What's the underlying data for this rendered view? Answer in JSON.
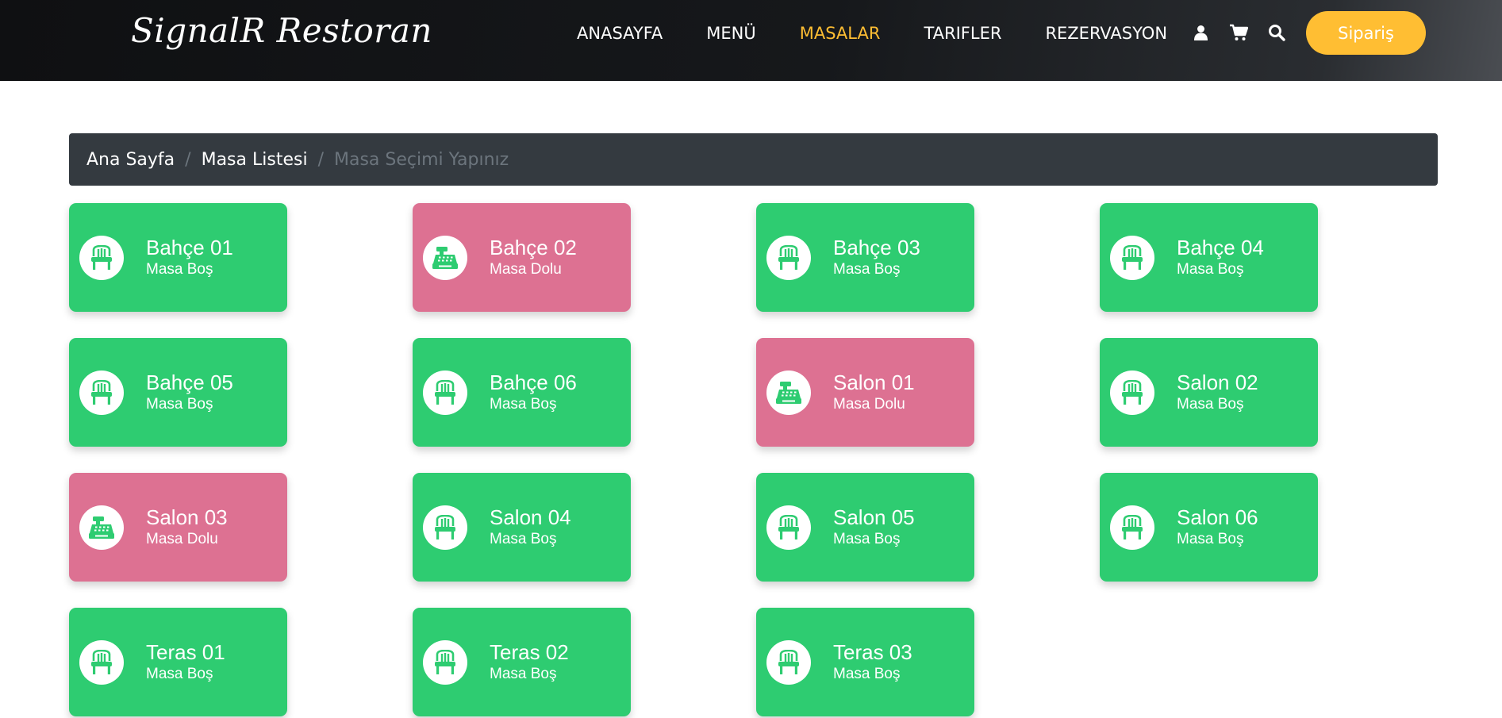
{
  "header": {
    "brand": "SignalR Restoran",
    "nav": [
      {
        "label": "ANASAYFA",
        "active": false
      },
      {
        "label": "MENÜ",
        "active": false
      },
      {
        "label": "MASALAR",
        "active": true
      },
      {
        "label": "TARIFLER",
        "active": false
      },
      {
        "label": "REZERVASYON",
        "active": false
      }
    ],
    "icons": [
      "user-icon",
      "cart-icon",
      "search-icon"
    ],
    "order_button": "Sipariş",
    "accent_color": "#ffbe33"
  },
  "breadcrumb": {
    "home": "Ana Sayfa",
    "list": "Masa Listesi",
    "current": "Masa Seçimi Yapınız"
  },
  "colors": {
    "bos": "#2ecc71",
    "dolu": "#dd7192"
  },
  "tables": [
    {
      "name": "Bahçe 01",
      "status": "Masa Boş",
      "state": "bos",
      "icon": "chair-icon"
    },
    {
      "name": "Bahçe 02",
      "status": "Masa Dolu",
      "state": "dolu",
      "icon": "cash-register-icon"
    },
    {
      "name": "Bahçe 03",
      "status": "Masa Boş",
      "state": "bos",
      "icon": "chair-icon"
    },
    {
      "name": "Bahçe 04",
      "status": "Masa Boş",
      "state": "bos",
      "icon": "chair-icon"
    },
    {
      "name": "Bahçe 05",
      "status": "Masa Boş",
      "state": "bos",
      "icon": "chair-icon"
    },
    {
      "name": "Bahçe 06",
      "status": "Masa Boş",
      "state": "bos",
      "icon": "chair-icon"
    },
    {
      "name": "Salon 01",
      "status": "Masa Dolu",
      "state": "dolu",
      "icon": "cash-register-icon"
    },
    {
      "name": "Salon 02",
      "status": "Masa Boş",
      "state": "bos",
      "icon": "chair-icon"
    },
    {
      "name": "Salon 03",
      "status": "Masa Dolu",
      "state": "dolu",
      "icon": "cash-register-icon"
    },
    {
      "name": "Salon 04",
      "status": "Masa Boş",
      "state": "bos",
      "icon": "chair-icon"
    },
    {
      "name": "Salon 05",
      "status": "Masa Boş",
      "state": "bos",
      "icon": "chair-icon"
    },
    {
      "name": "Salon 06",
      "status": "Masa Boş",
      "state": "bos",
      "icon": "chair-icon"
    },
    {
      "name": "Teras 01",
      "status": "Masa Boş",
      "state": "bos",
      "icon": "chair-icon"
    },
    {
      "name": "Teras 02",
      "status": "Masa Boş",
      "state": "bos",
      "icon": "chair-icon"
    },
    {
      "name": "Teras 03",
      "status": "Masa Boş",
      "state": "bos",
      "icon": "chair-icon"
    }
  ]
}
